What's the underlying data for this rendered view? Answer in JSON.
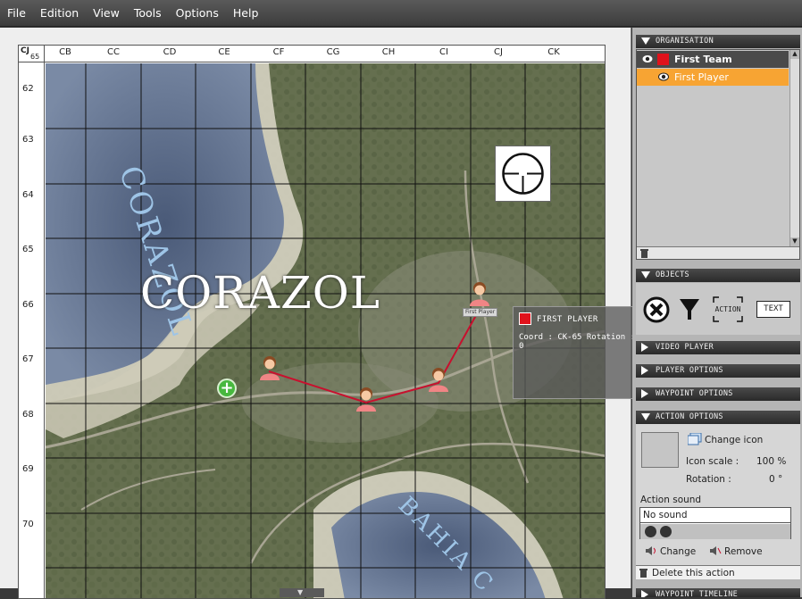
{
  "menu": [
    "File",
    "Edition",
    "View",
    "Tools",
    "Options",
    "Help"
  ],
  "grid": {
    "corner_top": "CJ",
    "corner_bottom": "65",
    "columns": [
      "CB",
      "CC",
      "CD",
      "CE",
      "CF",
      "CG",
      "CH",
      "CI",
      "CJ",
      "CK"
    ],
    "rows": [
      "62",
      "63",
      "64",
      "65",
      "66",
      "67",
      "68",
      "69",
      "70"
    ]
  },
  "map": {
    "label_lake": "CORAZOL",
    "label_town": "CORAZOL",
    "label_bay": "BAHIA C",
    "player_tag": "First Player"
  },
  "tooltip": {
    "name": "FIRST PLAYER",
    "coord": "Coord : CK-65 Rotation : 0"
  },
  "panel": {
    "organisation_title": "ORGANISATION",
    "team_name": "First Team",
    "player_name": "First Player",
    "objects_title": "OBJECTS",
    "action_button": "ACTION",
    "text_button": "TEXT",
    "video_player_title": "VIDEO PLAYER",
    "player_options_title": "PLAYER OPTIONS",
    "waypoint_options_title": "WAYPOINT OPTIONS",
    "action_options_title": "ACTION OPTIONS",
    "change_icon": "Change icon",
    "icon_scale_label": "Icon scale :",
    "icon_scale_value": "100 %",
    "rotation_label": "Rotation :",
    "rotation_value": "0 °",
    "action_sound_label": "Action sound",
    "sound_value": "No sound",
    "change_label": "Change",
    "remove_label": "Remove",
    "delete_action": "Delete this action",
    "bottom_title": "WAYPOINT TIMELINE"
  },
  "colors": {
    "team_red": "#e0121b",
    "selection_orange": "#f7a433",
    "route_red": "#c8102e"
  }
}
